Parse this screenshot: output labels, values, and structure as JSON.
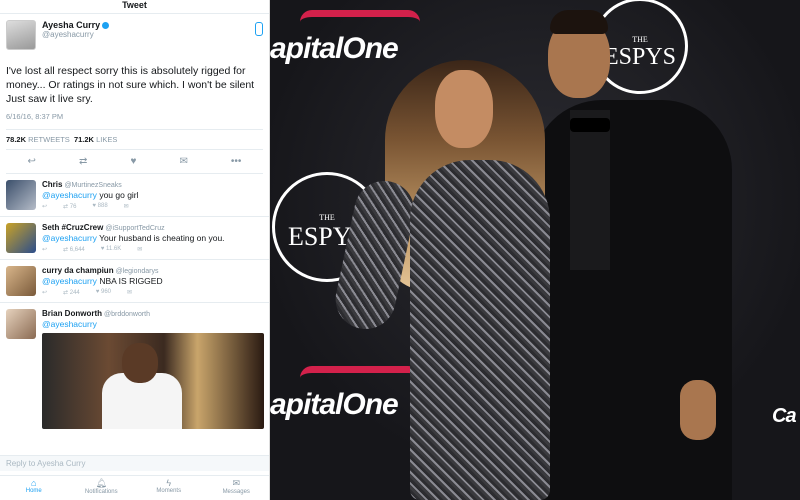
{
  "header": {
    "title": "Tweet"
  },
  "tweet": {
    "author_name": "Ayesha Curry",
    "author_handle": "@ayeshacurry",
    "text": "I've lost all respect sorry this is absolutely rigged for money... Or ratings in not sure which. I won't be silent Just saw it live sry.",
    "timestamp": "6/16/16, 8:37 PM",
    "retweets_count": "78.2K",
    "retweets_label": "RETWEETS",
    "likes_count": "71.2K",
    "likes_label": "LIKES"
  },
  "replies": [
    {
      "name": "Chris",
      "handle": "@MurtinezSneaks",
      "mention": "@ayeshacurry",
      "text": "you go girl",
      "retweets": "76",
      "likes": "888"
    },
    {
      "name": "Seth #CruzCrew",
      "handle": "@iSupportTedCruz",
      "mention": "@ayeshacurry",
      "text": "Your husband is cheating on you.",
      "retweets": "6,644",
      "likes": "11.6K"
    },
    {
      "name": "curry da champiun",
      "handle": "@legiondarys",
      "mention": "@ayeshacurry",
      "text": "NBA IS RIGGED",
      "retweets": "244",
      "likes": "960"
    },
    {
      "name": "Brian Donworth",
      "handle": "@brddonworth",
      "mention": "@ayeshacurry",
      "text": ""
    }
  ],
  "reply_box": {
    "placeholder": "Reply to Ayesha Curry"
  },
  "tabs": [
    {
      "label": "Home",
      "icon": "home-icon"
    },
    {
      "label": "Notifications",
      "icon": "bell-icon"
    },
    {
      "label": "Moments",
      "icon": "lightning-icon"
    },
    {
      "label": "Messages",
      "icon": "envelope-icon"
    }
  ],
  "photo": {
    "logo_top": "apitalOne",
    "logo_bottom": "apitalOne",
    "espys_label": "ESPYS",
    "espys_the": "THE",
    "edge_text": "Ca"
  },
  "colors": {
    "accent": "#1da1f2",
    "brand_red": "#d3214b"
  }
}
